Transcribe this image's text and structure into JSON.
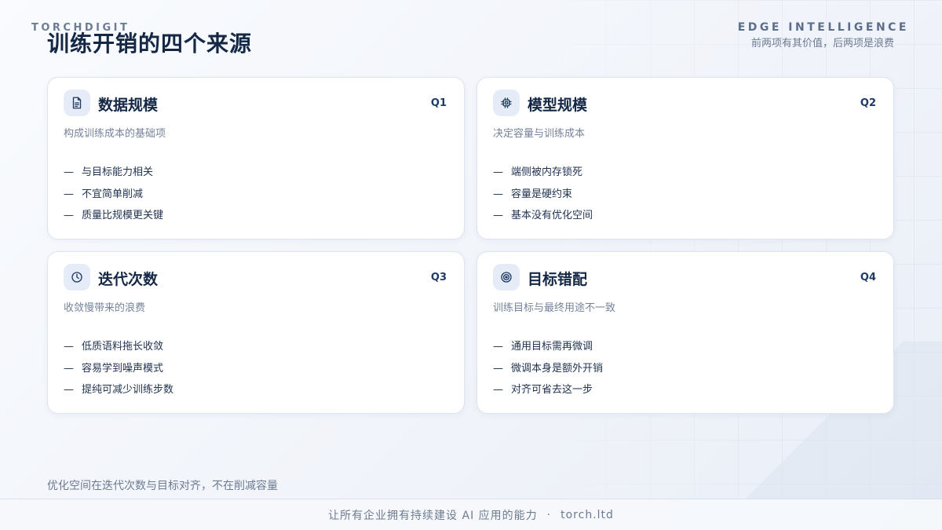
{
  "header": {
    "brand": "TORCHDIGIT",
    "title": "训练开销的四个来源",
    "edge_label": "EDGE INTELLIGENCE",
    "edge_sub": "前两项有其价值，后两项是浪费"
  },
  "cards": [
    {
      "icon": "document-icon",
      "title": "数据规模",
      "tag": "Q1",
      "subtitle": "构成训练成本的基础项",
      "items": [
        "与目标能力相关",
        "不宜简单削减",
        "质量比规模更关键"
      ]
    },
    {
      "icon": "chip-icon",
      "title": "模型规模",
      "tag": "Q2",
      "subtitle": "决定容量与训练成本",
      "items": [
        "端侧被内存锁死",
        "容量是硬约束",
        "基本没有优化空间"
      ]
    },
    {
      "icon": "clock-icon",
      "title": "迭代次数",
      "tag": "Q3",
      "subtitle": "收敛慢带来的浪费",
      "items": [
        "低质语料拖长收敛",
        "容易学到噪声模式",
        "提纯可减少训练步数"
      ]
    },
    {
      "icon": "target-icon",
      "title": "目标错配",
      "tag": "Q4",
      "subtitle": "训练目标与最终用途不一致",
      "items": [
        "通用目标需再微调",
        "微调本身是额外开销",
        "对齐可省去这一步"
      ]
    }
  ],
  "list_marker": "—",
  "footnote": "优化空间在迭代次数与目标对齐，不在削减容量",
  "footer": {
    "slogan": "让所有企业拥有持续建设 AI 应用的能力",
    "separator": "·",
    "site": "torch.ltd"
  }
}
